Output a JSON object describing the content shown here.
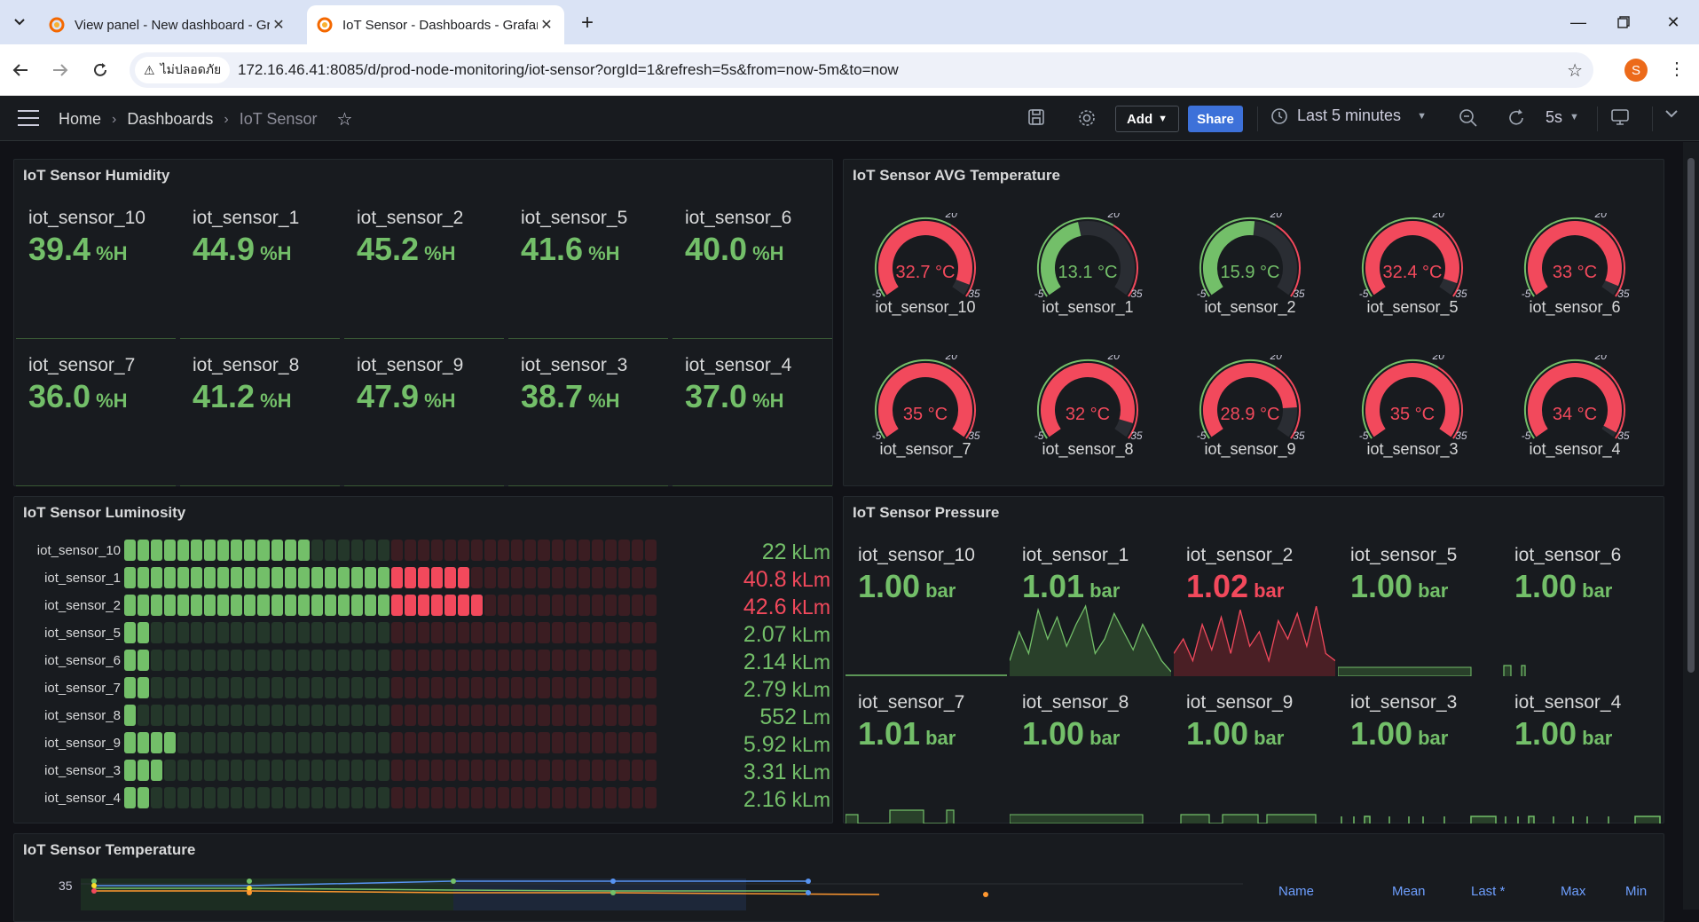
{
  "browser": {
    "tabs": [
      {
        "title": "View panel - New dashboard - Grafana",
        "active": false
      },
      {
        "title": "IoT Sensor - Dashboards - Grafana",
        "active": true
      }
    ],
    "security_label": "ไม่ปลอดภัย",
    "url": "172.16.46.41:8085/d/prod-node-monitoring/iot-sensor?orgId=1&refresh=5s&from=now-5m&to=now",
    "profile_initial": "S"
  },
  "nav": {
    "breadcrumbs": [
      "Home",
      "Dashboards",
      "IoT Sensor"
    ],
    "add_label": "Add",
    "share_label": "Share",
    "time_range": "Last 5 minutes",
    "refresh_interval": "5s"
  },
  "humidity": {
    "title": "IoT Sensor Humidity",
    "unit": "%H",
    "sensors": [
      {
        "name": "iot_sensor_10",
        "value": "39.4"
      },
      {
        "name": "iot_sensor_1",
        "value": "44.9"
      },
      {
        "name": "iot_sensor_2",
        "value": "45.2"
      },
      {
        "name": "iot_sensor_5",
        "value": "41.6"
      },
      {
        "name": "iot_sensor_6",
        "value": "40.0"
      },
      {
        "name": "iot_sensor_7",
        "value": "36.0"
      },
      {
        "name": "iot_sensor_8",
        "value": "41.2"
      },
      {
        "name": "iot_sensor_9",
        "value": "47.9"
      },
      {
        "name": "iot_sensor_3",
        "value": "38.7"
      },
      {
        "name": "iot_sensor_4",
        "value": "37.0"
      }
    ]
  },
  "avg_temperature": {
    "title": "IoT Sensor AVG Temperature",
    "scale_min": "-5",
    "scale_threshold": "20",
    "scale_max": "35",
    "sensors": [
      {
        "name": "iot_sensor_10",
        "value": "32.7 °C",
        "level": 32.7,
        "status": "red"
      },
      {
        "name": "iot_sensor_1",
        "value": "13.1 °C",
        "level": 13.1,
        "status": "green"
      },
      {
        "name": "iot_sensor_2",
        "value": "15.9 °C",
        "level": 15.9,
        "status": "green"
      },
      {
        "name": "iot_sensor_5",
        "value": "32.4 °C",
        "level": 32.4,
        "status": "red"
      },
      {
        "name": "iot_sensor_6",
        "value": "33 °C",
        "level": 33,
        "status": "red"
      },
      {
        "name": "iot_sensor_7",
        "value": "35 °C",
        "level": 35,
        "status": "red"
      },
      {
        "name": "iot_sensor_8",
        "value": "32 °C",
        "level": 32,
        "status": "red"
      },
      {
        "name": "iot_sensor_9",
        "value": "28.9 °C",
        "level": 28.9,
        "status": "red"
      },
      {
        "name": "iot_sensor_3",
        "value": "35 °C",
        "level": 35,
        "status": "red"
      },
      {
        "name": "iot_sensor_4",
        "value": "34 °C",
        "level": 34,
        "status": "red"
      }
    ]
  },
  "luminosity": {
    "title": "IoT Sensor Luminosity",
    "sensors": [
      {
        "name": "iot_sensor_10",
        "value": "22",
        "unit": "kLm",
        "lit_cells": 14,
        "status": "green"
      },
      {
        "name": "iot_sensor_1",
        "value": "40.8",
        "unit": "kLm",
        "lit_cells": 26,
        "status": "red"
      },
      {
        "name": "iot_sensor_2",
        "value": "42.6",
        "unit": "kLm",
        "lit_cells": 27,
        "status": "red"
      },
      {
        "name": "iot_sensor_5",
        "value": "2.07",
        "unit": "kLm",
        "lit_cells": 2,
        "status": "green"
      },
      {
        "name": "iot_sensor_6",
        "value": "2.14",
        "unit": "kLm",
        "lit_cells": 2,
        "status": "green"
      },
      {
        "name": "iot_sensor_7",
        "value": "2.79",
        "unit": "kLm",
        "lit_cells": 2,
        "status": "green"
      },
      {
        "name": "iot_sensor_8",
        "value": "552",
        "unit": "Lm",
        "lit_cells": 1,
        "status": "green"
      },
      {
        "name": "iot_sensor_9",
        "value": "5.92",
        "unit": "kLm",
        "lit_cells": 4,
        "status": "green"
      },
      {
        "name": "iot_sensor_3",
        "value": "3.31",
        "unit": "kLm",
        "lit_cells": 3,
        "status": "green"
      },
      {
        "name": "iot_sensor_4",
        "value": "2.16",
        "unit": "kLm",
        "lit_cells": 2,
        "status": "green"
      }
    ]
  },
  "pressure": {
    "title": "IoT Sensor Pressure",
    "unit": "bar",
    "sensors": [
      {
        "name": "iot_sensor_10",
        "value": "1.00",
        "status": "green"
      },
      {
        "name": "iot_sensor_1",
        "value": "1.01",
        "status": "green"
      },
      {
        "name": "iot_sensor_2",
        "value": "1.02",
        "status": "red"
      },
      {
        "name": "iot_sensor_5",
        "value": "1.00",
        "status": "green"
      },
      {
        "name": "iot_sensor_6",
        "value": "1.00",
        "status": "green"
      },
      {
        "name": "iot_sensor_7",
        "value": "1.01",
        "status": "green"
      },
      {
        "name": "iot_sensor_8",
        "value": "1.00",
        "status": "green"
      },
      {
        "name": "iot_sensor_9",
        "value": "1.00",
        "status": "green"
      },
      {
        "name": "iot_sensor_3",
        "value": "1.00",
        "status": "green"
      },
      {
        "name": "iot_sensor_4",
        "value": "1.00",
        "status": "green"
      }
    ]
  },
  "temperature": {
    "title": "IoT Sensor Temperature",
    "y_tick": "35",
    "legend_headers": [
      "Name",
      "Mean",
      "Last *",
      "Max",
      "Min"
    ]
  },
  "colors": {
    "green": "#73bf69",
    "red": "#f2495c",
    "accent_blue": "#3d71d9",
    "panel_bg": "#181b1f"
  }
}
